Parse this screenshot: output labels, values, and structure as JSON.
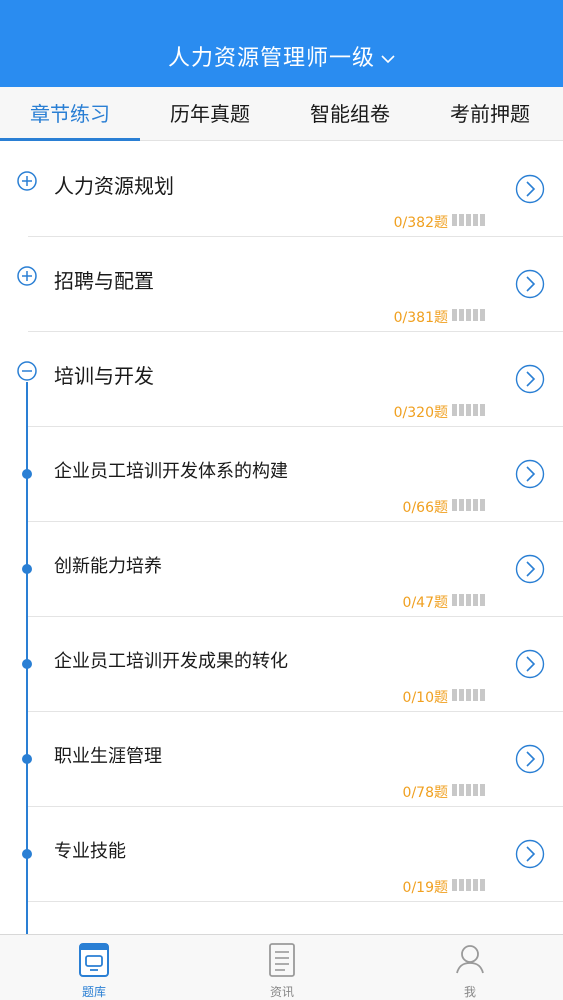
{
  "header": {
    "title": "人力资源管理师一级"
  },
  "tabs": [
    {
      "label": "章节练习"
    },
    {
      "label": "历年真题"
    },
    {
      "label": "智能组卷"
    },
    {
      "label": "考前押题"
    }
  ],
  "chapters": [
    {
      "title": "人力资源规划",
      "count": "0/382题",
      "state": "collapsed"
    },
    {
      "title": "招聘与配置",
      "count": "0/381题",
      "state": "collapsed"
    },
    {
      "title": "培训与开发",
      "count": "0/320题",
      "state": "expanded"
    }
  ],
  "sections": [
    {
      "title": "企业员工培训开发体系的构建",
      "count": "0/66题"
    },
    {
      "title": "创新能力培养",
      "count": "0/47题"
    },
    {
      "title": "企业员工培训开发成果的转化",
      "count": "0/10题"
    },
    {
      "title": "职业生涯管理",
      "count": "0/78题"
    },
    {
      "title": "专业技能",
      "count": "0/19题"
    }
  ],
  "bottom_nav": [
    {
      "label": "题库"
    },
    {
      "label": "资讯"
    },
    {
      "label": "我"
    }
  ],
  "colors": {
    "header_blue": "#2a8cf0",
    "accent_blue": "#2a7fd4",
    "count_orange": "#f0a020"
  }
}
